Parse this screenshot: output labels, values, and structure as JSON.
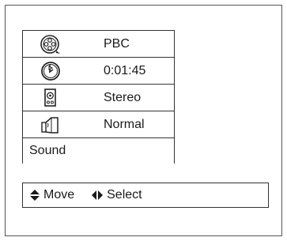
{
  "menu": {
    "items": [
      {
        "label": "PBC",
        "icon": "film-reel-icon"
      },
      {
        "label": "0:01:45",
        "icon": "clock-icon"
      },
      {
        "label": "Stereo",
        "icon": "speaker-icon"
      },
      {
        "label": "Normal",
        "icon": "surround-speaker-icon"
      }
    ],
    "sound_label": "Sound"
  },
  "footer": {
    "move_label": "Move",
    "select_label": "Select"
  }
}
